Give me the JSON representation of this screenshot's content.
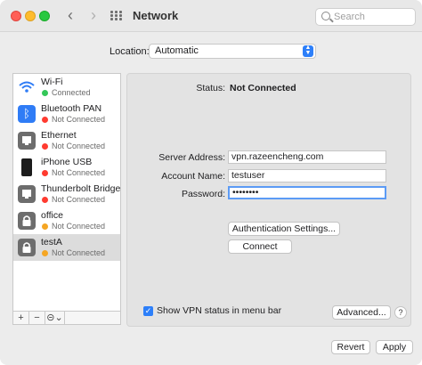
{
  "window": {
    "title": "Network"
  },
  "toolbar": {
    "back_icon": "chevron-left-icon",
    "forward_icon": "chevron-right-icon",
    "grid_icon": "show-all-grid-icon",
    "search_placeholder": "Search"
  },
  "location": {
    "label": "Location:",
    "value": "Automatic"
  },
  "services": [
    {
      "name": "Wi-Fi",
      "status": "Connected",
      "status_color": "#34c759",
      "icon": "wifi-icon"
    },
    {
      "name": "Bluetooth PAN",
      "status": "Not Connected",
      "status_color": "#ff3b30",
      "icon": "bluetooth-icon"
    },
    {
      "name": "Ethernet",
      "status": "Not Connected",
      "status_color": "#ff3b30",
      "icon": "ethernet-icon"
    },
    {
      "name": "iPhone USB",
      "status": "Not Connected",
      "status_color": "#ff3b30",
      "icon": "iphone-icon"
    },
    {
      "name": "Thunderbolt Bridge",
      "status": "Not Connected",
      "status_color": "#ff3b30",
      "icon": "thunderbolt-bridge-icon"
    },
    {
      "name": "office",
      "status": "Not Connected",
      "status_color": "#f5a623",
      "icon": "vpn-lock-icon"
    },
    {
      "name": "testA",
      "status": "Not Connected",
      "status_color": "#f5a623",
      "icon": "vpn-lock-icon",
      "selected": true
    }
  ],
  "sidebar_tools": {
    "add": "+",
    "remove": "−",
    "actions": "⊝⌄"
  },
  "detail": {
    "status_label": "Status:",
    "status_value": "Not Connected",
    "server_label": "Server Address:",
    "server_value": "vpn.razeencheng.com",
    "account_label": "Account Name:",
    "account_value": "testuser",
    "password_label": "Password:",
    "password_value": "••••••••",
    "auth_button": "Authentication Settings...",
    "connect_button": "Connect",
    "show_vpn_label": "Show VPN status in menu bar",
    "show_vpn_checked": true,
    "advanced_button": "Advanced...",
    "help_label": "?"
  },
  "footer": {
    "revert_button": "Revert",
    "apply_button": "Apply"
  }
}
